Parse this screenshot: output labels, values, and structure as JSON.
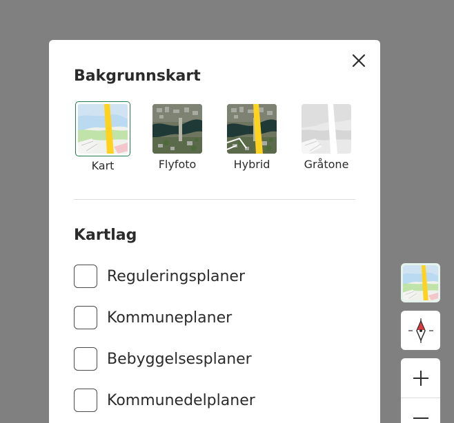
{
  "dialog": {
    "close_label": "Close",
    "basemap_title": "Bakgrunnskart",
    "basemaps": [
      {
        "label": "Kart",
        "selected": true,
        "icon": "map-thumbnail-icon"
      },
      {
        "label": "Flyfoto",
        "selected": false,
        "icon": "aerial-photo-thumbnail-icon"
      },
      {
        "label": "Hybrid",
        "selected": false,
        "icon": "hybrid-thumbnail-icon"
      },
      {
        "label": "Gråtone",
        "selected": false,
        "icon": "grayscale-thumbnail-icon"
      }
    ],
    "layers_title": "Kartlag",
    "layers": [
      {
        "label": "Reguleringsplaner",
        "checked": false
      },
      {
        "label": "Kommuneplaner",
        "checked": false
      },
      {
        "label": "Bebyggelsesplaner",
        "checked": false
      },
      {
        "label": "Kommunedelplaner",
        "checked": false
      }
    ]
  },
  "map_controls": {
    "basemap_icon": "map-thumbnail-icon",
    "compass_icon": "compass-icon",
    "zoom_in_icon": "plus-icon",
    "zoom_out_icon": "minus-icon"
  },
  "colors": {
    "backdrop": "#808080",
    "panel": "#ffffff",
    "selected_border": "#1f7a4d",
    "road_yellow": "#ffd21f",
    "compass_red": "#d93b3b"
  }
}
